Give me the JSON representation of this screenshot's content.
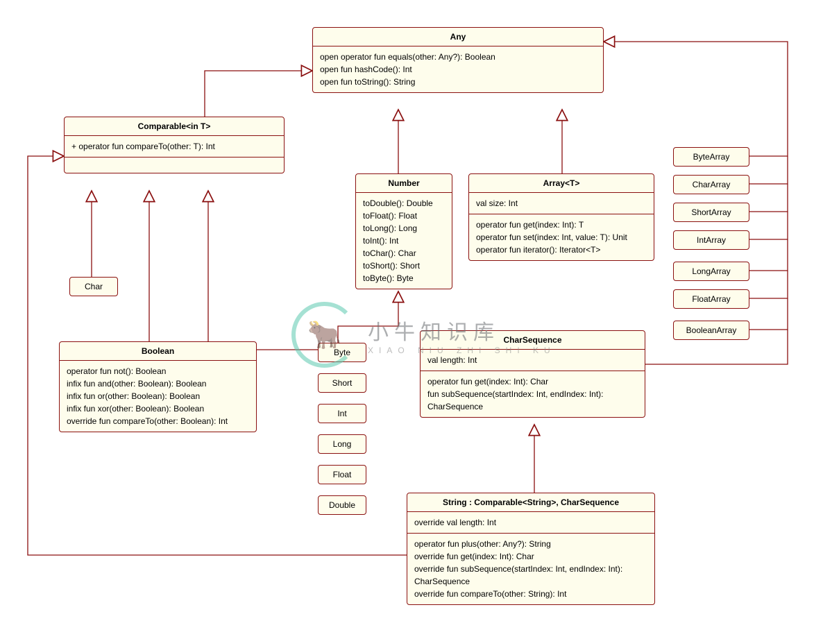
{
  "classes": {
    "any": {
      "title": "Any",
      "methods": {
        "m1": "open operator fun equals(other: Any?): Boolean",
        "m2": "open fun hashCode(): Int",
        "m3": "open fun toString(): String"
      }
    },
    "comparable": {
      "title": "Comparable<in T>",
      "methods": {
        "m1": "+ operator fun compareTo(other: T): Int"
      }
    },
    "number": {
      "title": "Number",
      "methods": {
        "m1": "toDouble(): Double",
        "m2": "toFloat(): Float",
        "m3": "toLong(): Long",
        "m4": "toInt(): Int",
        "m5": "toChar(): Char",
        "m6": "toShort(): Short",
        "m7": "toByte(): Byte"
      }
    },
    "array": {
      "title": "Array<T>",
      "props": {
        "p1": "val size: Int"
      },
      "methods": {
        "m1": "operator fun get(index: Int): T",
        "m2": "operator fun set(index: Int, value: T): Unit",
        "m3": "operator fun iterator(): Iterator<T>"
      }
    },
    "boolean": {
      "title": "Boolean",
      "methods": {
        "m1": "operator fun not(): Boolean",
        "m2": "infix fun and(other: Boolean): Boolean",
        "m3": "infix fun or(other: Boolean): Boolean",
        "m4": "infix fun xor(other: Boolean): Boolean",
        "m5": "override fun compareTo(other: Boolean): Int"
      }
    },
    "charseq": {
      "title": "CharSequence",
      "props": {
        "p1": "val length: Int"
      },
      "methods": {
        "m1": "operator fun get(index: Int): Char",
        "m2": "fun subSequence(startIndex: Int, endIndex: Int): CharSequence"
      }
    },
    "string": {
      "title": "String : Comparable<String>, CharSequence",
      "props": {
        "p1": "override val length: Int"
      },
      "methods": {
        "m1": "operator fun plus(other: Any?): String",
        "m2": "override fun get(index: Int): Char",
        "m3": "override fun subSequence(startIndex: Int, endIndex: Int): CharSequence",
        "m4": "override fun compareTo(other: String): Int"
      }
    }
  },
  "simple": {
    "char": "Char",
    "byte": "Byte",
    "short": "Short",
    "int": "Int",
    "long": "Long",
    "float": "Float",
    "double": "Double",
    "bytearray": "ByteArray",
    "chararray": "CharArray",
    "shortarray": "ShortArray",
    "intarray": "IntArray",
    "longarray": "LongArray",
    "floatarray": "FloatArray",
    "booleanarray": "BooleanArray"
  },
  "watermark": {
    "chinese": "小牛知识库",
    "pinyin": "XIAO NIU ZHI SHI KU"
  }
}
